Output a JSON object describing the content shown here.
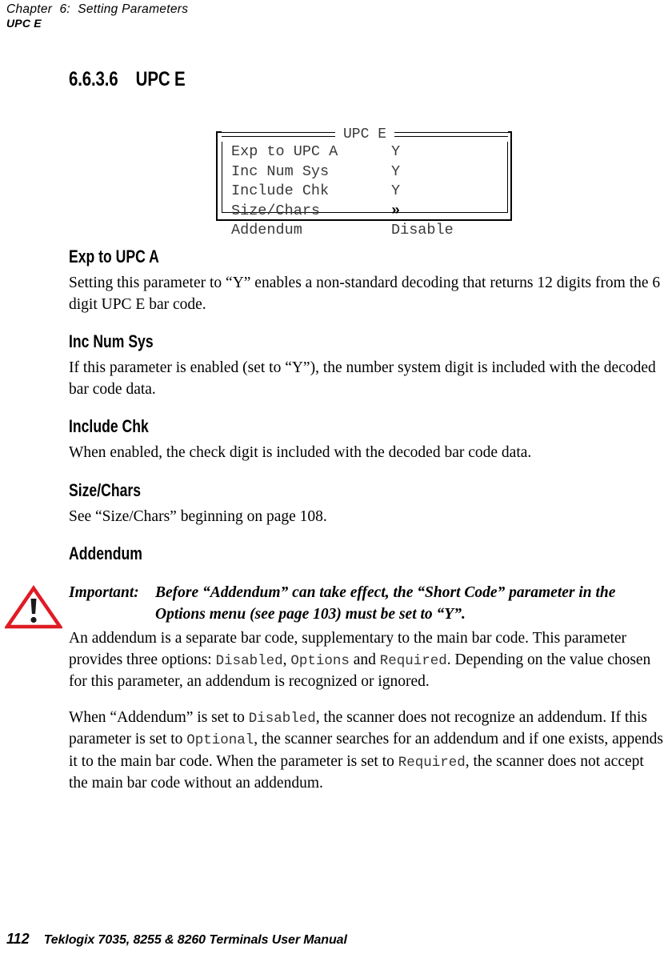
{
  "header": {
    "chapter": "Chapter  6:  Setting Parameters",
    "topic": "UPC E"
  },
  "section": {
    "number": "6.6.3.6",
    "title": "UPC E"
  },
  "lcd_menu": {
    "title": "UPC E",
    "rows": [
      {
        "label": "Exp to UPC A",
        "value": "Y"
      },
      {
        "label": "Inc Num Sys",
        "value": "Y"
      },
      {
        "label": "Include Chk",
        "value": "Y"
      },
      {
        "label": "Size/Chars",
        "value": "»"
      },
      {
        "label": "Addendum",
        "value": "Disable"
      }
    ]
  },
  "subsections": [
    {
      "heading": "Exp to UPC A",
      "paragraph": "Setting this parameter to “Y” enables a non-standard decoding that returns 12 digits from the 6 digit UPC E bar code."
    },
    {
      "heading": "Inc Num Sys",
      "paragraph": "If this parameter is enabled (set to “Y”), the number system digit is included with the decoded bar code data."
    },
    {
      "heading": "Include Chk",
      "paragraph": "When enabled, the check digit is included with the decoded bar code data."
    },
    {
      "heading": "Size/Chars",
      "paragraph": "See “Size/Chars” beginning on page 108."
    },
    {
      "heading": "Addendum"
    }
  ],
  "callout": {
    "icon": "warning-triangle-icon",
    "icon_color": "#e01b24",
    "label": "Important:",
    "text": "Before “Addendum” can take effect, the “Short Code” parameter in the Options menu (see page 103) must be set to “Y”."
  },
  "addendum_paragraphs": {
    "p1_a": "An addendum is a separate bar code, supplementary to the main bar code. This parameter provides three options: ",
    "p1_opt1": "Disabled",
    "p1_sep1": ", ",
    "p1_opt2": "Options",
    "p1_sep2": " and ",
    "p1_opt3": "Required",
    "p1_b": ". Depending on the value chosen for this parameter, an addendum is recognized or ignored.",
    "p2_a": "When “Addendum” is set to ",
    "p2_opt1": "Disabled",
    "p2_b": ", the scanner does not recognize an addendum. If this parameter is set to ",
    "p2_opt2": "Optional",
    "p2_c": ", the scanner searches for an addendum and if one exists, appends it to the main bar code. When the parameter is set to ",
    "p2_opt3": "Required",
    "p2_d": ", the scanner does not accept the main bar code without an addendum."
  },
  "footer": {
    "page_number": "112",
    "manual_title": "Teklogix 7035, 8255 & 8260 Terminals User Manual"
  }
}
